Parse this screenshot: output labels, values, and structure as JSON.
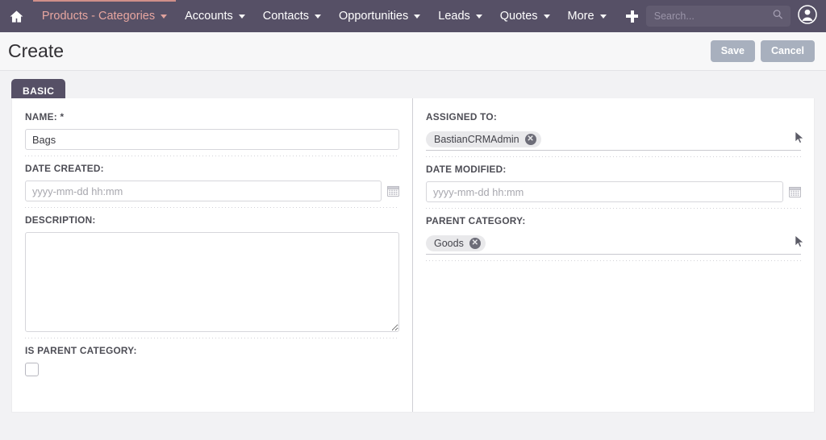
{
  "navbar": {
    "home_icon": "home-icon",
    "items": [
      {
        "label": "Products - Categories",
        "active": true
      },
      {
        "label": "Accounts",
        "active": false
      },
      {
        "label": "Contacts",
        "active": false
      },
      {
        "label": "Opportunities",
        "active": false
      },
      {
        "label": "Leads",
        "active": false
      },
      {
        "label": "Quotes",
        "active": false
      },
      {
        "label": "More",
        "active": false
      }
    ],
    "plus_icon": "plus-icon",
    "search": {
      "placeholder": "Search...",
      "value": "",
      "icon": "search-icon"
    },
    "avatar_icon": "user-avatar-icon",
    "background_color": "#565066",
    "active_color": "#e7a6a0"
  },
  "header": {
    "title": "Create",
    "save_label": "Save",
    "cancel_label": "Cancel",
    "button_color": "#a8b0be"
  },
  "tabs": [
    {
      "label": "BASIC",
      "active": true
    }
  ],
  "form": {
    "left": {
      "name": {
        "label": "NAME:",
        "required_marker": "*",
        "value": "Bags",
        "placeholder": ""
      },
      "date_created": {
        "label": "DATE CREATED:",
        "value": "",
        "placeholder": "yyyy-mm-dd hh:mm",
        "calendar_icon": "calendar-icon"
      },
      "description": {
        "label": "DESCRIPTION:",
        "value": "",
        "placeholder": ""
      },
      "is_parent_category": {
        "label": "IS PARENT CATEGORY:",
        "checked": false
      }
    },
    "right": {
      "assigned_to": {
        "label": "ASSIGNED TO:",
        "tag": "BastianCRMAdmin",
        "remove_label": "✕",
        "select_icon": "cursor-arrow-icon"
      },
      "date_modified": {
        "label": "DATE MODIFIED:",
        "value": "",
        "placeholder": "yyyy-mm-dd hh:mm",
        "calendar_icon": "calendar-icon"
      },
      "parent_category": {
        "label": "PARENT CATEGORY:",
        "tag": "Goods",
        "remove_label": "✕",
        "select_icon": "cursor-arrow-icon"
      }
    }
  }
}
